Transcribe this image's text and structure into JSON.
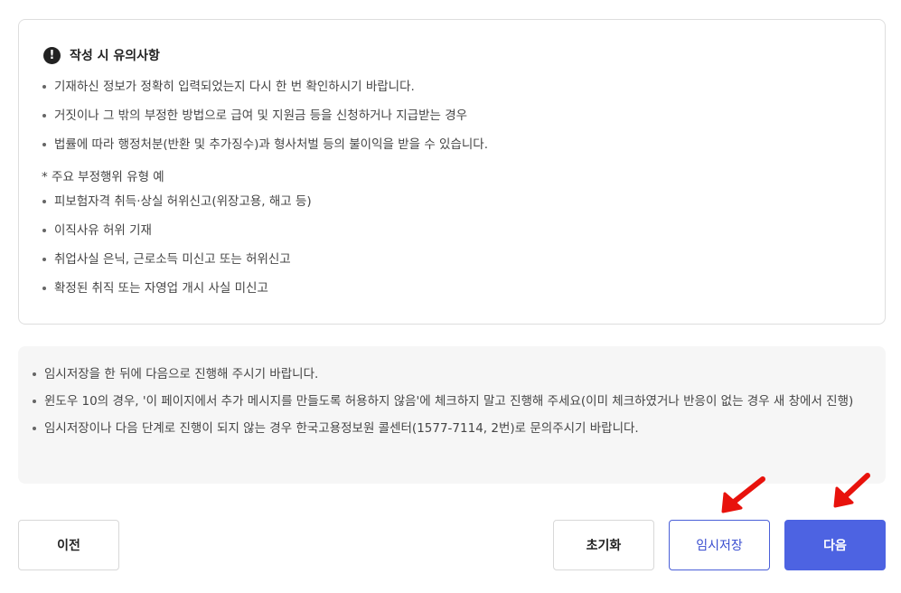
{
  "notice": {
    "icon": "exclamation-icon",
    "title": "작성 시 유의사항",
    "items": [
      "기재하신 정보가 정확히 입력되었는지 다시 한 번 확인하시기 바랍니다.",
      "거짓이나 그 밖의 부정한 방법으로 급여 및 지원금 등을 신청하거나 지급받는 경우",
      "법률에 따라 행정처분(반환 및 추가징수)과 형사처벌 등의 불이익을 받을 수 있습니다."
    ],
    "sub_heading": "* 주요 부정행위 유형 예",
    "examples": [
      "피보험자격 취득·상실 허위신고(위장고용, 해고 등)",
      "이직사유 허위 기재",
      "취업사실 은닉, 근로소득 미신고 또는 허위신고",
      "확정된 취직 또는 자영업 개시 사실 미신고"
    ]
  },
  "info": {
    "items": [
      "임시저장을 한 뒤에 다음으로 진행해 주시기 바랍니다.",
      "윈도우 10의 경우, '이 페이지에서 추가 메시지를 만들도록 허용하지 않음'에 체크하지 말고 진행해 주세요(이미 체크하였거나 반응이 없는 경우 새 창에서 진행)",
      "임시저장이나 다음 단계로 진행이 되지 않는 경우 한국고용정보원 콜센터(1577-7114, 2번)로 문의주시기 바랍니다."
    ]
  },
  "buttons": {
    "prev": "이전",
    "reset": "초기화",
    "temp_save": "임시저장",
    "next": "다음"
  },
  "colors": {
    "primary": "#4d63e2",
    "annotation_arrow": "#e8120c"
  }
}
